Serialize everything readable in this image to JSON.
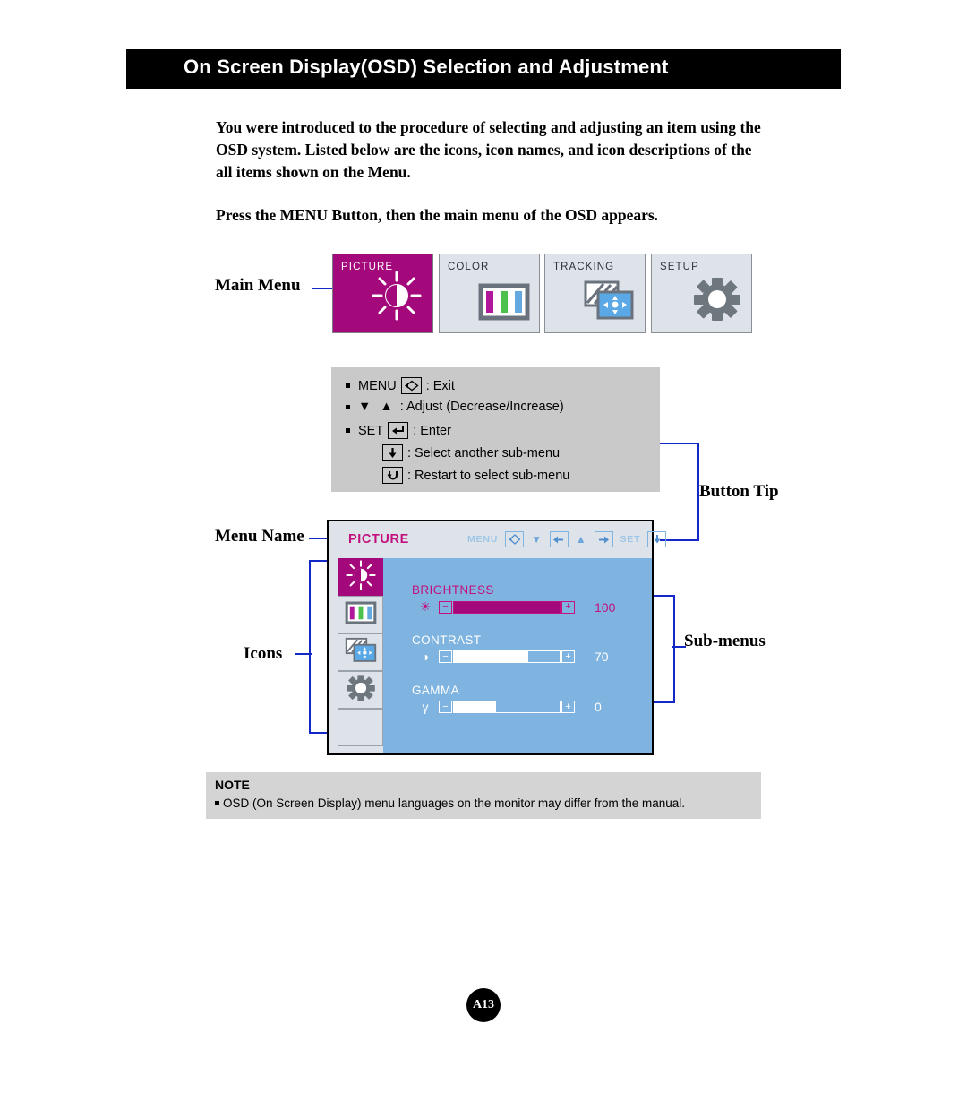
{
  "header": {
    "title": "On Screen Display(OSD) Selection and Adjustment"
  },
  "intro": {
    "paragraph1": "You were introduced to the procedure of selecting and adjusting an item using the OSD system.  Listed below are the icons, icon names, and icon descriptions of the all items shown on the Menu.",
    "paragraph2": "Press the MENU Button, then the main menu of the OSD appears."
  },
  "callouts": {
    "main_menu": "Main Menu",
    "menu_name": "Menu Name",
    "icons": "Icons",
    "button_tip": "Button Tip",
    "sub_menus": "Sub-menus"
  },
  "main_menu_tiles": [
    {
      "label": "PICTURE",
      "icon": "brightness-icon",
      "selected": true
    },
    {
      "label": "COLOR",
      "icon": "color-bars-icon",
      "selected": false
    },
    {
      "label": "TRACKING",
      "icon": "tracking-icon",
      "selected": false
    },
    {
      "label": "SETUP",
      "icon": "gear-icon",
      "selected": false
    }
  ],
  "button_tip": {
    "lines": [
      {
        "bullet": true,
        "prefix": "MENU",
        "key": "⬦",
        "suffix": ": Exit"
      },
      {
        "bullet": true,
        "prefix": "▼ ▲",
        "key": "",
        "suffix": ": Adjust (Decrease/Increase)"
      },
      {
        "bullet": true,
        "prefix": "SET",
        "key": "↵",
        "suffix": ": Enter"
      },
      {
        "bullet": false,
        "prefix": "",
        "key": "⬇",
        "suffix": ": Select another sub-menu"
      },
      {
        "bullet": false,
        "prefix": "",
        "key": "↺",
        "suffix": ": Restart to select sub-menu"
      }
    ]
  },
  "osd": {
    "menu_name": "PICTURE",
    "header_buttons": [
      {
        "label": "MENU",
        "icon": "menu-exit-icon",
        "glyph": "⬦"
      },
      {
        "label": "▼",
        "icon": "left-arrow-icon",
        "glyph": "←"
      },
      {
        "label": "▲",
        "icon": "right-arrow-icon",
        "glyph": "→"
      },
      {
        "label": "SET",
        "icon": "down-arrow-icon",
        "glyph": "⬇"
      }
    ],
    "side_icons": [
      {
        "icon": "brightness-icon",
        "selected": true
      },
      {
        "icon": "color-bars-icon",
        "selected": false
      },
      {
        "icon": "tracking-icon",
        "selected": false
      },
      {
        "icon": "gear-icon",
        "selected": false
      },
      {
        "icon": "blank-icon",
        "selected": false
      }
    ],
    "rows": [
      {
        "name": "BRIGHTNESS",
        "glyph": "☀",
        "value": "100",
        "percent": 100,
        "highlighted": true
      },
      {
        "name": "CONTRAST",
        "glyph": "◑",
        "value": "70",
        "percent": 70,
        "highlighted": false
      },
      {
        "name": "GAMMA",
        "glyph": "γ",
        "value": "0",
        "percent": 40,
        "highlighted": false
      }
    ]
  },
  "note": {
    "title": "NOTE",
    "text": "OSD (On Screen Display) menu languages on the monitor may differ from the manual."
  },
  "page_number": "A13",
  "colors": {
    "accent_magenta": "#a4097c",
    "text_magenta": "#c2117f",
    "osd_blue": "#7fb4e0",
    "panel_grey": "#dde3e8",
    "connector_blue": "#1428c8"
  }
}
